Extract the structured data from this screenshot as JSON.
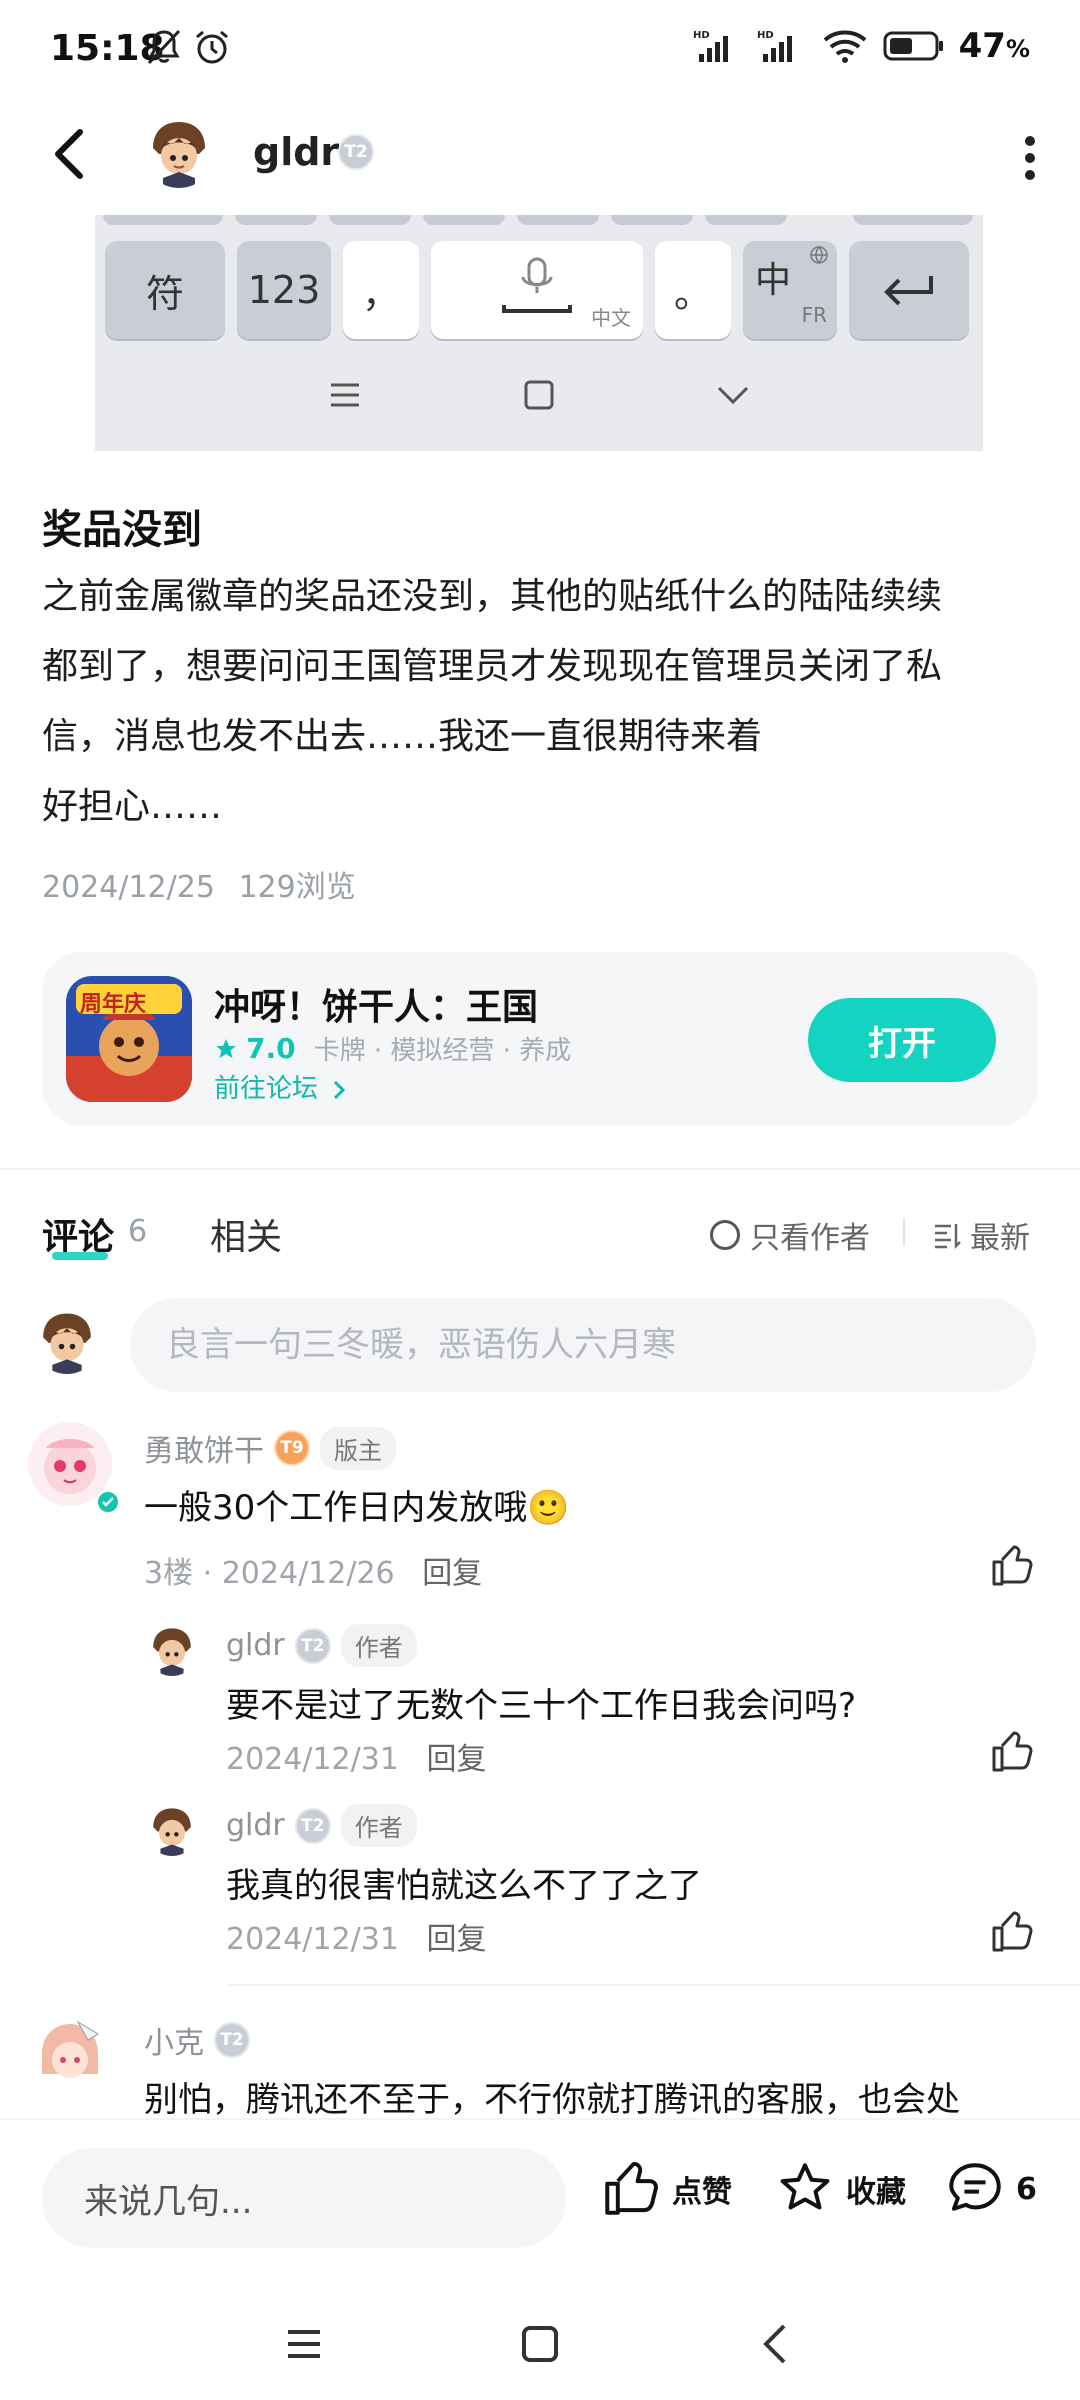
{
  "status_bar": {
    "time": "15:18",
    "battery_level": "47",
    "battery_unit": "%",
    "icons": [
      "bell-off-icon",
      "alarm-icon",
      "hd-signal-icon",
      "wifi-icon",
      "battery-icon"
    ]
  },
  "header": {
    "username": "gldr",
    "level": "T2"
  },
  "post": {
    "title": "奖品没到",
    "body_lines": [
      "之前金属徽章的奖品还没到，其他的贴纸什么的陆陆续续",
      "都到了，想要问问王国管理员才发现现在管理员关闭了私",
      "信，消息也发不出去……我还一直很期待来着",
      "好担心……"
    ],
    "date": "2024/12/25",
    "views": "129浏览"
  },
  "keyboard": {
    "keys": [
      "符",
      "123",
      "，",
      "中文",
      "。",
      "中",
      "FR"
    ]
  },
  "game_card": {
    "name": "冲呀！饼干人：王国",
    "rating": "7.0",
    "tags": "卡牌 · 模拟经营 · 养成",
    "forum_link": "前往论坛",
    "open_button": "打开",
    "icon_label": "周年庆"
  },
  "tabs": {
    "comments_label": "评论",
    "comments_count": "6",
    "related_label": "相关",
    "author_only": "只看作者",
    "latest": "最新"
  },
  "comment_input": {
    "placeholder": "良言一句三冬暖，恶语伤人六月寒"
  },
  "comments": [
    {
      "name": "勇敢饼干",
      "level": "T9",
      "tag": "版主",
      "text": "一般30个工作日内发放哦🙂",
      "floor": "3楼",
      "date": "2024/12/26",
      "reply": "回复"
    },
    {
      "name": "gldr",
      "level": "T2",
      "tag": "作者",
      "text": "要不是过了无数个三十个工作日我会问吗?",
      "date": "2024/12/31",
      "reply": "回复"
    },
    {
      "name": "gldr",
      "level": "T2",
      "tag": "作者",
      "text": "我真的很害怕就这么不了了之了",
      "date": "2024/12/31",
      "reply": "回复"
    },
    {
      "name": "小克",
      "level": "T2",
      "text": "别怕，腾讯还不至于，不行你就打腾讯的客服，也会处"
    }
  ],
  "action_bar": {
    "input_placeholder": "来说几句...",
    "like_label": "点赞",
    "favorite_label": "收藏",
    "comment_count": "6"
  },
  "colors": {
    "accent": "#14d3c0",
    "text_primary": "#111111",
    "text_secondary": "#9aa0a8",
    "card_bg": "#f4f6f8"
  }
}
